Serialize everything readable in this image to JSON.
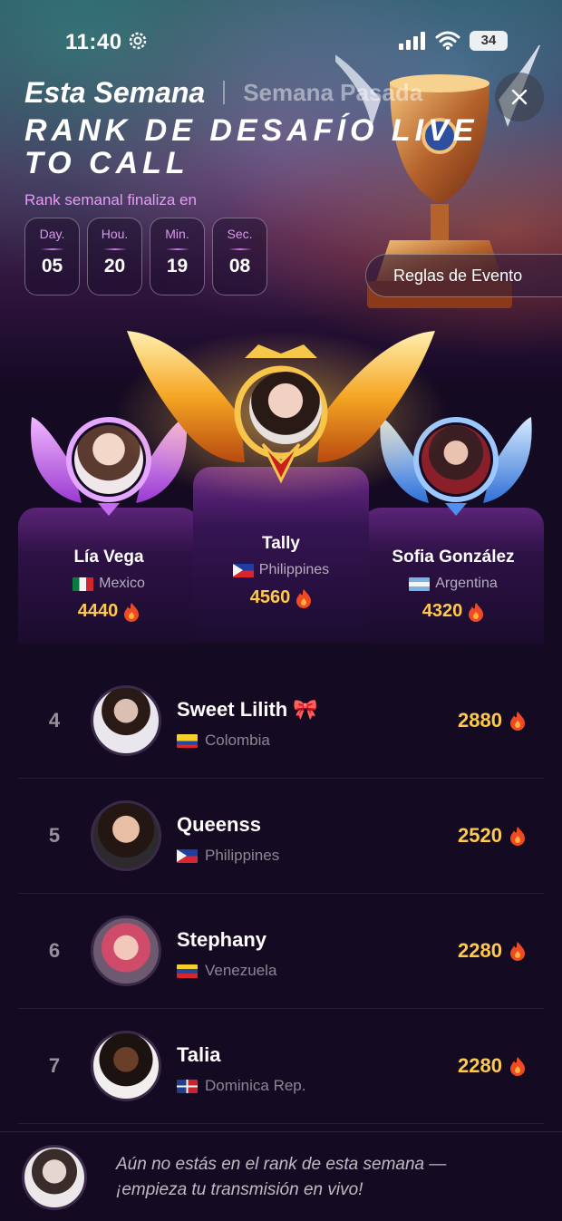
{
  "status_bar": {
    "time": "11:40",
    "battery": "34"
  },
  "tabs": {
    "active": "Esta Semana",
    "inactive": "Semana Pasada"
  },
  "event": {
    "title": "RANK DE DESAFÍO LIVE TO CALL",
    "countdown_label": "Rank semanal finaliza en",
    "countdown": [
      {
        "unit": "Day.",
        "value": "05"
      },
      {
        "unit": "Hou.",
        "value": "20"
      },
      {
        "unit": "Min.",
        "value": "19"
      },
      {
        "unit": "Sec.",
        "value": "08"
      }
    ],
    "rules_label": "Reglas de Evento"
  },
  "podium": {
    "first": {
      "name": "Tally",
      "country": "Philippines",
      "score": "4560"
    },
    "second": {
      "name": "Lía Vega",
      "country": "Mexico",
      "score": "4440"
    },
    "third": {
      "name": "Sofia González",
      "country": "Argentina",
      "score": "4320"
    }
  },
  "ranking": [
    {
      "rank": "4",
      "name": "Sweet Lilith",
      "emoji": "🎀",
      "country": "Colombia",
      "flag": "co",
      "score": "2880"
    },
    {
      "rank": "5",
      "name": "Queenss",
      "emoji": "",
      "country": "Philippines",
      "flag": "ph",
      "score": "2520"
    },
    {
      "rank": "6",
      "name": "Stephany",
      "emoji": "",
      "country": "Venezuela",
      "flag": "ve",
      "score": "2280"
    },
    {
      "rank": "7",
      "name": "Talia",
      "emoji": "",
      "country": "Dominica Rep.",
      "flag": "do",
      "score": "2280"
    }
  ],
  "footer": {
    "message": "Aún no estás en el rank de esta semana — ¡empieza tu transmisión en vivo!"
  },
  "colors": {
    "accent_gold": "#ffc94a",
    "countdown_pink": "#e99af5",
    "background": "#140a22"
  },
  "icons": {
    "flame": "flame-icon",
    "close": "close-icon",
    "gear": "gear-icon"
  }
}
